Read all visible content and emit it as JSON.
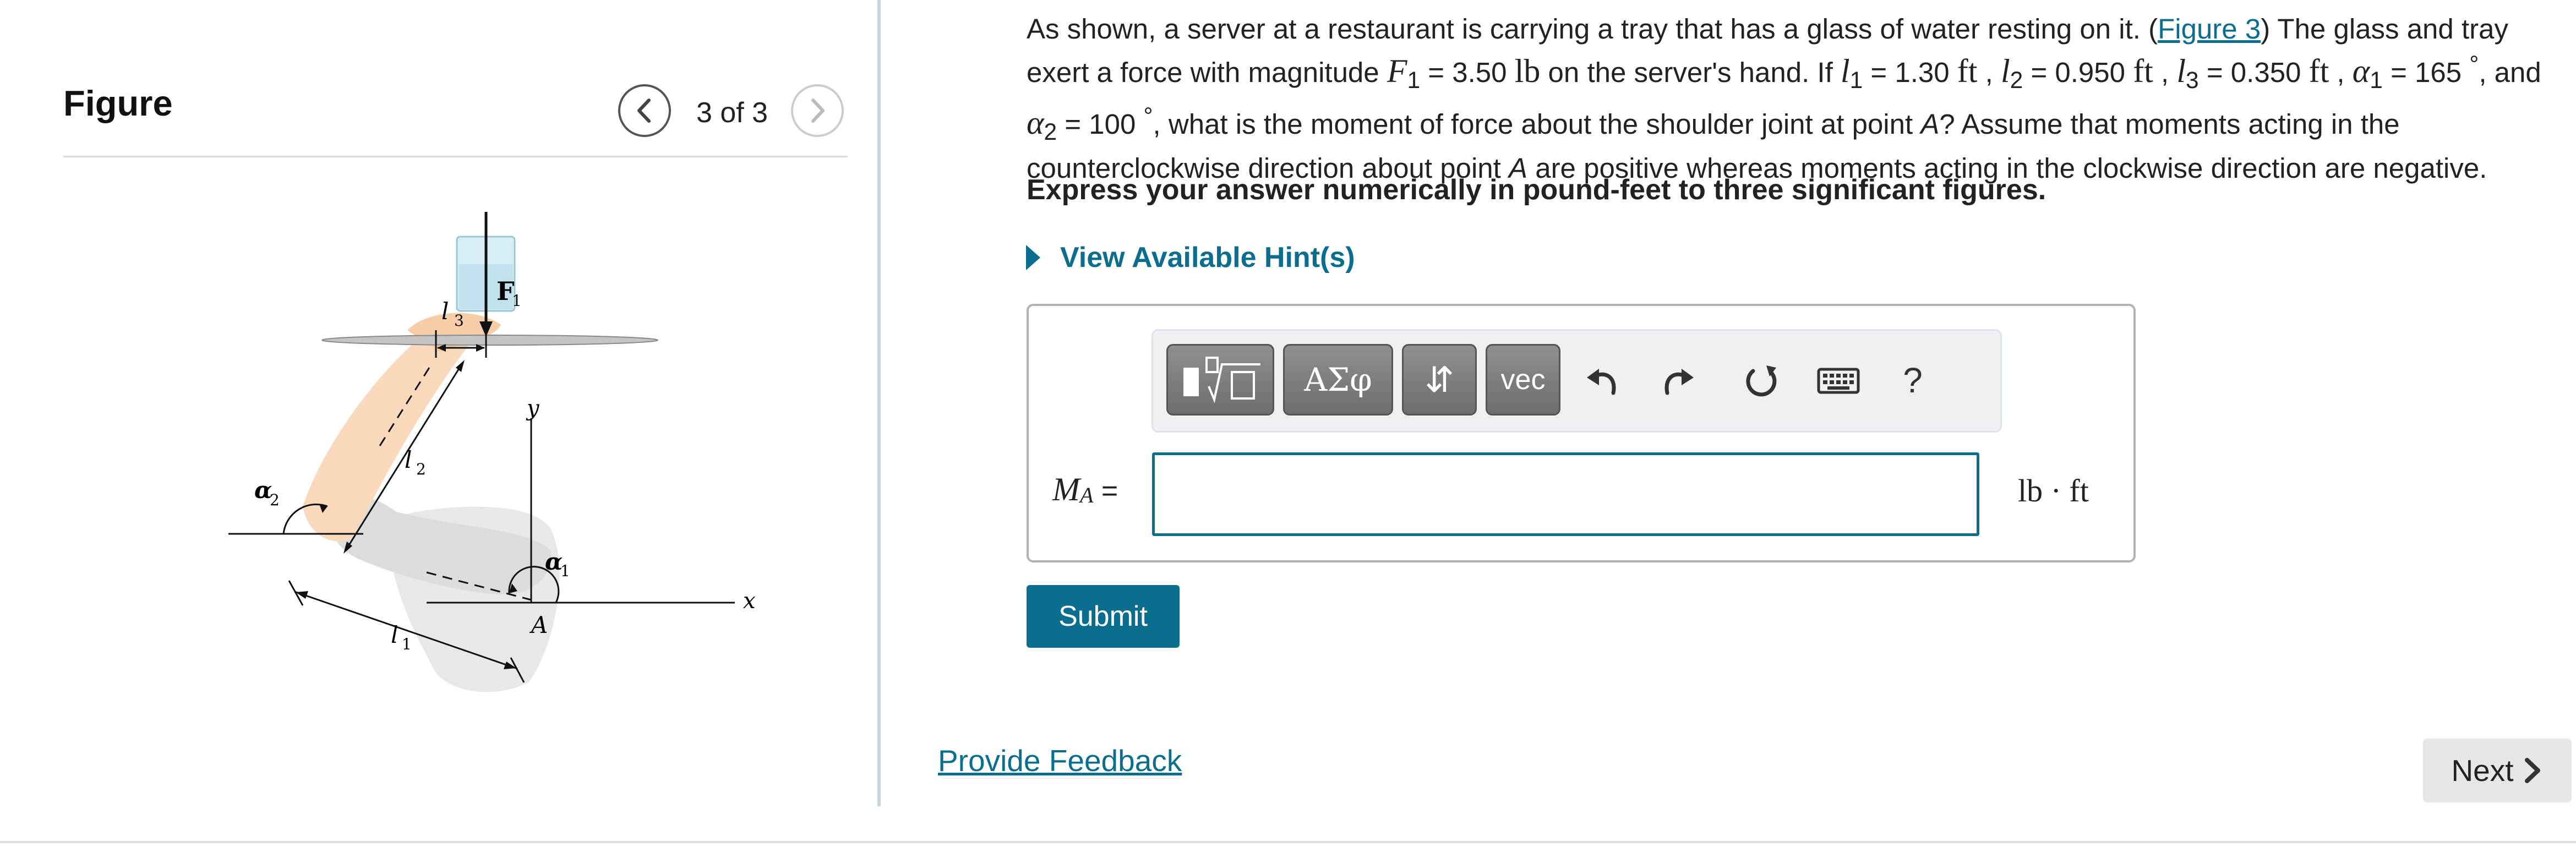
{
  "figure_panel": {
    "title": "Figure",
    "page_counter": "3 of 3",
    "diagram_labels": {
      "force": "F",
      "force_sub": "1",
      "l1": "l",
      "l1_sub": "1",
      "l2": "l",
      "l2_sub": "2",
      "l3": "l",
      "l3_sub": "3",
      "alpha1": "α",
      "alpha1_sub": "1",
      "alpha2": "α",
      "alpha2_sub": "2",
      "point_a": "A",
      "axis_x": "x",
      "axis_y": "y"
    }
  },
  "problem": {
    "text_before_link": "As shown, a server at a restaurant is carrying a tray that has a glass of water resting on it. (",
    "figure_link": "Figure 3",
    "text_after_link": ") The glass and tray exert a force with magnitude ",
    "f1_sym": "F",
    "f1_sub": "1",
    "f1_value": " = 3.50 ",
    "f1_unit": "lb",
    "text_if": " on the server's hand. If ",
    "l1_sym": "l",
    "l1_sub": "1",
    "l1_value": " = 1.30 ",
    "l1_unit": "ft",
    "sep1": " , ",
    "l2_sym": "l",
    "l2_sub": "2",
    "l2_value": " = 0.950 ",
    "l2_unit": "ft",
    "sep2": " , ",
    "l3_sym": "l",
    "l3_sub": "3",
    "l3_value": " = 0.350 ",
    "l3_unit": "ft",
    "sep3": " , ",
    "a1_sym": "α",
    "a1_sub": "1",
    "a1_value": " = 165 ",
    "degree": "°",
    "sep4": ", and ",
    "a2_sym": "α",
    "a2_sub": "2",
    "a2_value": " = 100 ",
    "text_question": ", what is the moment of force about the shoulder joint at point ",
    "point": "A",
    "text_assume": "? Assume that moments acting in the counterclockwise direction about point ",
    "point2": "A",
    "text_end": " are positive whereas moments acting in the clockwise direction are negative."
  },
  "instruction": "Express your answer numerically in pound-feet to three significant figures.",
  "hint_label": "View Available Hint(s)",
  "toolbar": {
    "greek_label": "ΑΣφ",
    "arrows_label": "⇵",
    "vec_label": "vec",
    "help_label": "?"
  },
  "answer": {
    "label_sym": "M",
    "label_sub": "A",
    "label_eq": " =",
    "value": "",
    "unit": "lb · ft"
  },
  "submit_label": "Submit",
  "feedback_label": "Provide Feedback",
  "next_label": "Next"
}
